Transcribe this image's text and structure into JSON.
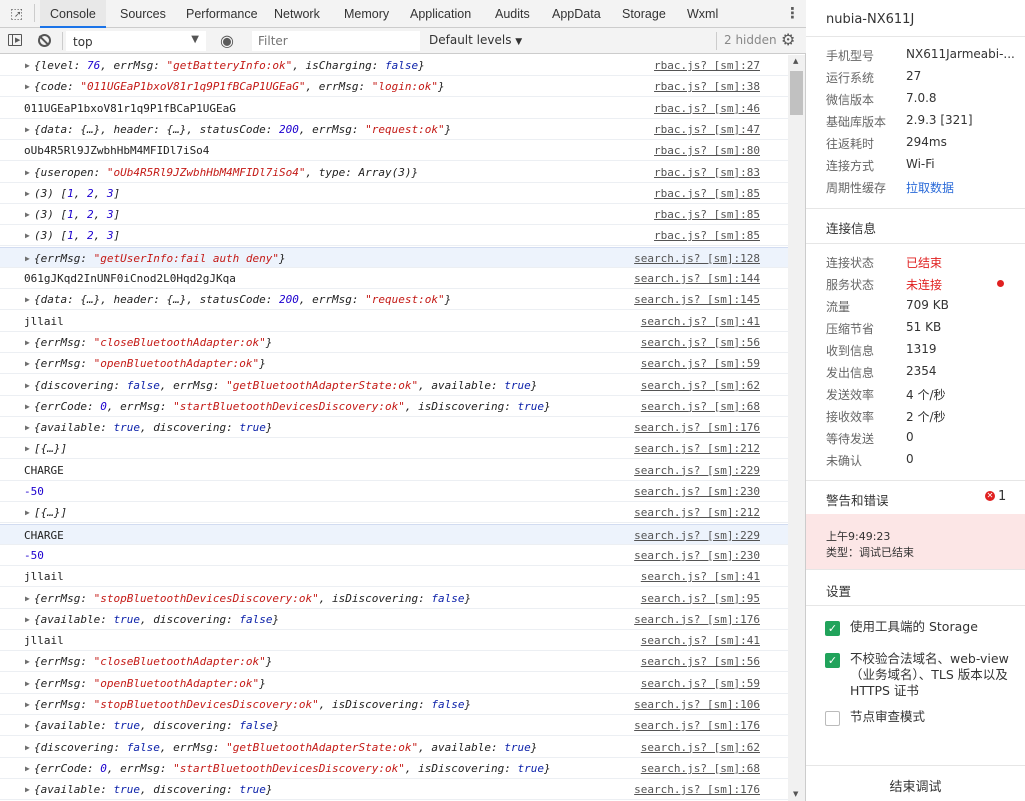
{
  "tabs": [
    "Console",
    "Sources",
    "Performance",
    "Network",
    "Memory",
    "Application",
    "Audits",
    "AppData",
    "Storage",
    "Wxml"
  ],
  "toolbar": {
    "context": "top",
    "filter_placeholder": "Filter",
    "levels": "Default levels",
    "hidden": "2 hidden"
  },
  "log": [
    {
      "k": "o",
      "h": "<i>{</i><i>level: </i><span class='n'>76</span>, errMsg: <span class='s'>\"getBatteryInfo:ok\"</span>, isCharging: <span class='b'>false</span>}",
      "src": "rbac.js? [sm]:27"
    },
    {
      "k": "o",
      "h": "{code: <span class='s'>\"011UGEaP1bxoV81r1q9P1fBCaP1UGEaG\"</span>, errMsg: <span class='s'>\"login:ok\"</span>}",
      "src": "rbac.js? [sm]:38"
    },
    {
      "k": "p",
      "t": "011UGEaP1bxoV81r1q9P1fBCaP1UGEaG",
      "src": "rbac.js? [sm]:46"
    },
    {
      "k": "o",
      "h": "{data: {…}, header: {…}, statusCode: <span class='n'>200</span>, errMsg: <span class='s'>\"request:ok\"</span>}",
      "src": "rbac.js? [sm]:47"
    },
    {
      "k": "p",
      "t": "oUb4R5Rl9JZwbhHbM4MFIDl7iSo4",
      "src": "rbac.js? [sm]:80"
    },
    {
      "k": "o",
      "h": "{useropen: <span class='s'>\"oUb4R5Rl9JZwbhHbM4MFIDl7iSo4\"</span>, type: Array(3)}",
      "src": "rbac.js? [sm]:83"
    },
    {
      "k": "o",
      "h": "(3) [<span class='n'>1</span>, <span class='n'>2</span>, <span class='n'>3</span>]",
      "src": "rbac.js? [sm]:85"
    },
    {
      "k": "o",
      "h": "(3) [<span class='n'>1</span>, <span class='n'>2</span>, <span class='n'>3</span>]",
      "src": "rbac.js? [sm]:85"
    },
    {
      "k": "o",
      "h": "(3) [<span class='n'>1</span>, <span class='n'>2</span>, <span class='n'>3</span>]",
      "src": "rbac.js? [sm]:85"
    },
    {
      "k": "o",
      "sel": true,
      "h": "{errMsg: <span class='s'>\"getUserInfo:fail auth deny\"</span>}",
      "src": "search.js? [sm]:128"
    },
    {
      "k": "p",
      "t": "061gJKqd2InUNF0iCnod2L0Hqd2gJKqa",
      "src": "search.js? [sm]:144"
    },
    {
      "k": "o",
      "h": "{data: {…}, header: {…}, statusCode: <span class='n'>200</span>, errMsg: <span class='s'>\"request:ok\"</span>}",
      "src": "search.js? [sm]:145"
    },
    {
      "k": "p",
      "t": "jllail",
      "src": "search.js? [sm]:41"
    },
    {
      "k": "o",
      "h": "{errMsg: <span class='s'>\"closeBluetoothAdapter:ok\"</span>}",
      "src": "search.js? [sm]:56"
    },
    {
      "k": "o",
      "h": "{errMsg: <span class='s'>\"openBluetoothAdapter:ok\"</span>}",
      "src": "search.js? [sm]:59"
    },
    {
      "k": "o",
      "h": "{discovering: <span class='b'>false</span>, errMsg: <span class='s'>\"getBluetoothAdapterState:ok\"</span>, available: <span class='b'>true</span>}",
      "src": "search.js? [sm]:62"
    },
    {
      "k": "o",
      "h": "{errCode: <span class='n'>0</span>, errMsg: <span class='s'>\"startBluetoothDevicesDiscovery:ok\"</span>, isDiscovering: <span class='b'>true</span>}",
      "src": "search.js? [sm]:68"
    },
    {
      "k": "o",
      "h": "{available: <span class='b'>true</span>, discovering: <span class='b'>true</span>}",
      "src": "search.js? [sm]:176"
    },
    {
      "k": "o",
      "h": "[{…}]",
      "src": "search.js? [sm]:212"
    },
    {
      "k": "p",
      "t": "CHARGE",
      "src": "search.js? [sm]:229"
    },
    {
      "k": "n",
      "t": "-50",
      "src": "search.js? [sm]:230"
    },
    {
      "k": "o",
      "h": "[{…}]",
      "src": "search.js? [sm]:212"
    },
    {
      "k": "p",
      "sel": true,
      "t": "CHARGE",
      "src": "search.js? [sm]:229"
    },
    {
      "k": "n",
      "t": "-50",
      "src": "search.js? [sm]:230"
    },
    {
      "k": "p",
      "t": "jllail",
      "src": "search.js? [sm]:41"
    },
    {
      "k": "o",
      "h": "{errMsg: <span class='s'>\"stopBluetoothDevicesDiscovery:ok\"</span>, isDiscovering: <span class='b'>false</span>}",
      "src": "search.js? [sm]:95"
    },
    {
      "k": "o",
      "h": "{available: <span class='b'>true</span>, discovering: <span class='b'>false</span>}",
      "src": "search.js? [sm]:176"
    },
    {
      "k": "p",
      "t": "jllail",
      "src": "search.js? [sm]:41"
    },
    {
      "k": "o",
      "h": "{errMsg: <span class='s'>\"closeBluetoothAdapter:ok\"</span>}",
      "src": "search.js? [sm]:56"
    },
    {
      "k": "o",
      "h": "{errMsg: <span class='s'>\"openBluetoothAdapter:ok\"</span>}",
      "src": "search.js? [sm]:59"
    },
    {
      "k": "o",
      "h": "{errMsg: <span class='s'>\"stopBluetoothDevicesDiscovery:ok\"</span>, isDiscovering: <span class='b'>false</span>}",
      "src": "search.js? [sm]:106"
    },
    {
      "k": "o",
      "h": "{available: <span class='b'>true</span>, discovering: <span class='b'>false</span>}",
      "src": "search.js? [sm]:176"
    },
    {
      "k": "o",
      "h": "{discovering: <span class='b'>false</span>, errMsg: <span class='s'>\"getBluetoothAdapterState:ok\"</span>, available: <span class='b'>true</span>}",
      "src": "search.js? [sm]:62"
    },
    {
      "k": "o",
      "h": "{errCode: <span class='n'>0</span>, errMsg: <span class='s'>\"startBluetoothDevicesDiscovery:ok\"</span>, isDiscovering: <span class='b'>true</span>}",
      "src": "search.js? [sm]:68"
    },
    {
      "k": "o",
      "h": "{available: <span class='b'>true</span>, discovering: <span class='b'>true</span>}",
      "src": "search.js? [sm]:176"
    }
  ],
  "side": {
    "device": "nubia-NX611J",
    "info": [
      [
        "手机型号",
        "NX611Jarmeabi-..."
      ],
      [
        "运行系统",
        "27"
      ],
      [
        "微信版本",
        "7.0.8"
      ],
      [
        "基础库版本",
        "2.9.3 [321]"
      ],
      [
        "往返耗时",
        "294ms"
      ],
      [
        "连接方式",
        "Wi-Fi"
      ],
      [
        "周期性缓存",
        "拉取数据"
      ]
    ],
    "conn_title": "连接信息",
    "conn": [
      [
        "连接状态",
        "已结束"
      ],
      [
        "服务状态",
        "未连接"
      ],
      [
        "流量",
        "709 KB"
      ],
      [
        "压缩节省",
        "51 KB"
      ],
      [
        "收到信息",
        "1319"
      ],
      [
        "发出信息",
        "2354"
      ],
      [
        "发送效率",
        "4 个/秒"
      ],
      [
        "接收效率",
        "2 个/秒"
      ],
      [
        "等待发送",
        "0"
      ],
      [
        "未确认",
        "0"
      ]
    ],
    "warn_title": "警告和错误",
    "warn_count": "1",
    "warn_time": "上午9:49:23",
    "warn_type": "类型：调试已结束",
    "settings_title": "设置",
    "settings": [
      [
        "使用工具端的 Storage",
        true
      ],
      [
        "不校验合法域名、web-view（业务域名）、TLS 版本以及 HTTPS 证书",
        true
      ],
      [
        "节点审查模式",
        false
      ]
    ],
    "end_button": "结束调试"
  }
}
